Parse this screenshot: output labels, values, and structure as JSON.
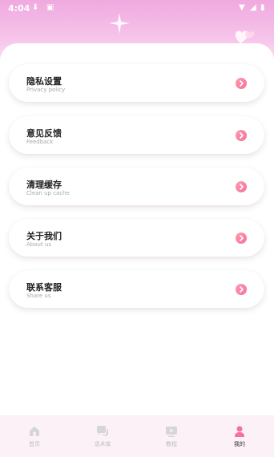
{
  "status_bar": {
    "time": "4:04"
  },
  "menu": {
    "items": [
      {
        "title": "隐私设置",
        "subtitle": "Privacy policy"
      },
      {
        "title": "意见反馈",
        "subtitle": "Feedback"
      },
      {
        "title": "清理缓存",
        "subtitle": "Clean up cache"
      },
      {
        "title": "关于我们",
        "subtitle": "About us"
      },
      {
        "title": "联系客服",
        "subtitle": "Share us"
      }
    ]
  },
  "tabbar": {
    "tabs": [
      {
        "label": "首页",
        "icon": "home-icon"
      },
      {
        "label": "话术库",
        "icon": "chat-icon"
      },
      {
        "label": "教程",
        "icon": "video-icon"
      },
      {
        "label": "我的",
        "icon": "user-icon",
        "active": true
      }
    ]
  },
  "colors": {
    "accent": "#f3719a",
    "header": "#f0a9df",
    "tabbar_bg": "#fdf1f8"
  }
}
